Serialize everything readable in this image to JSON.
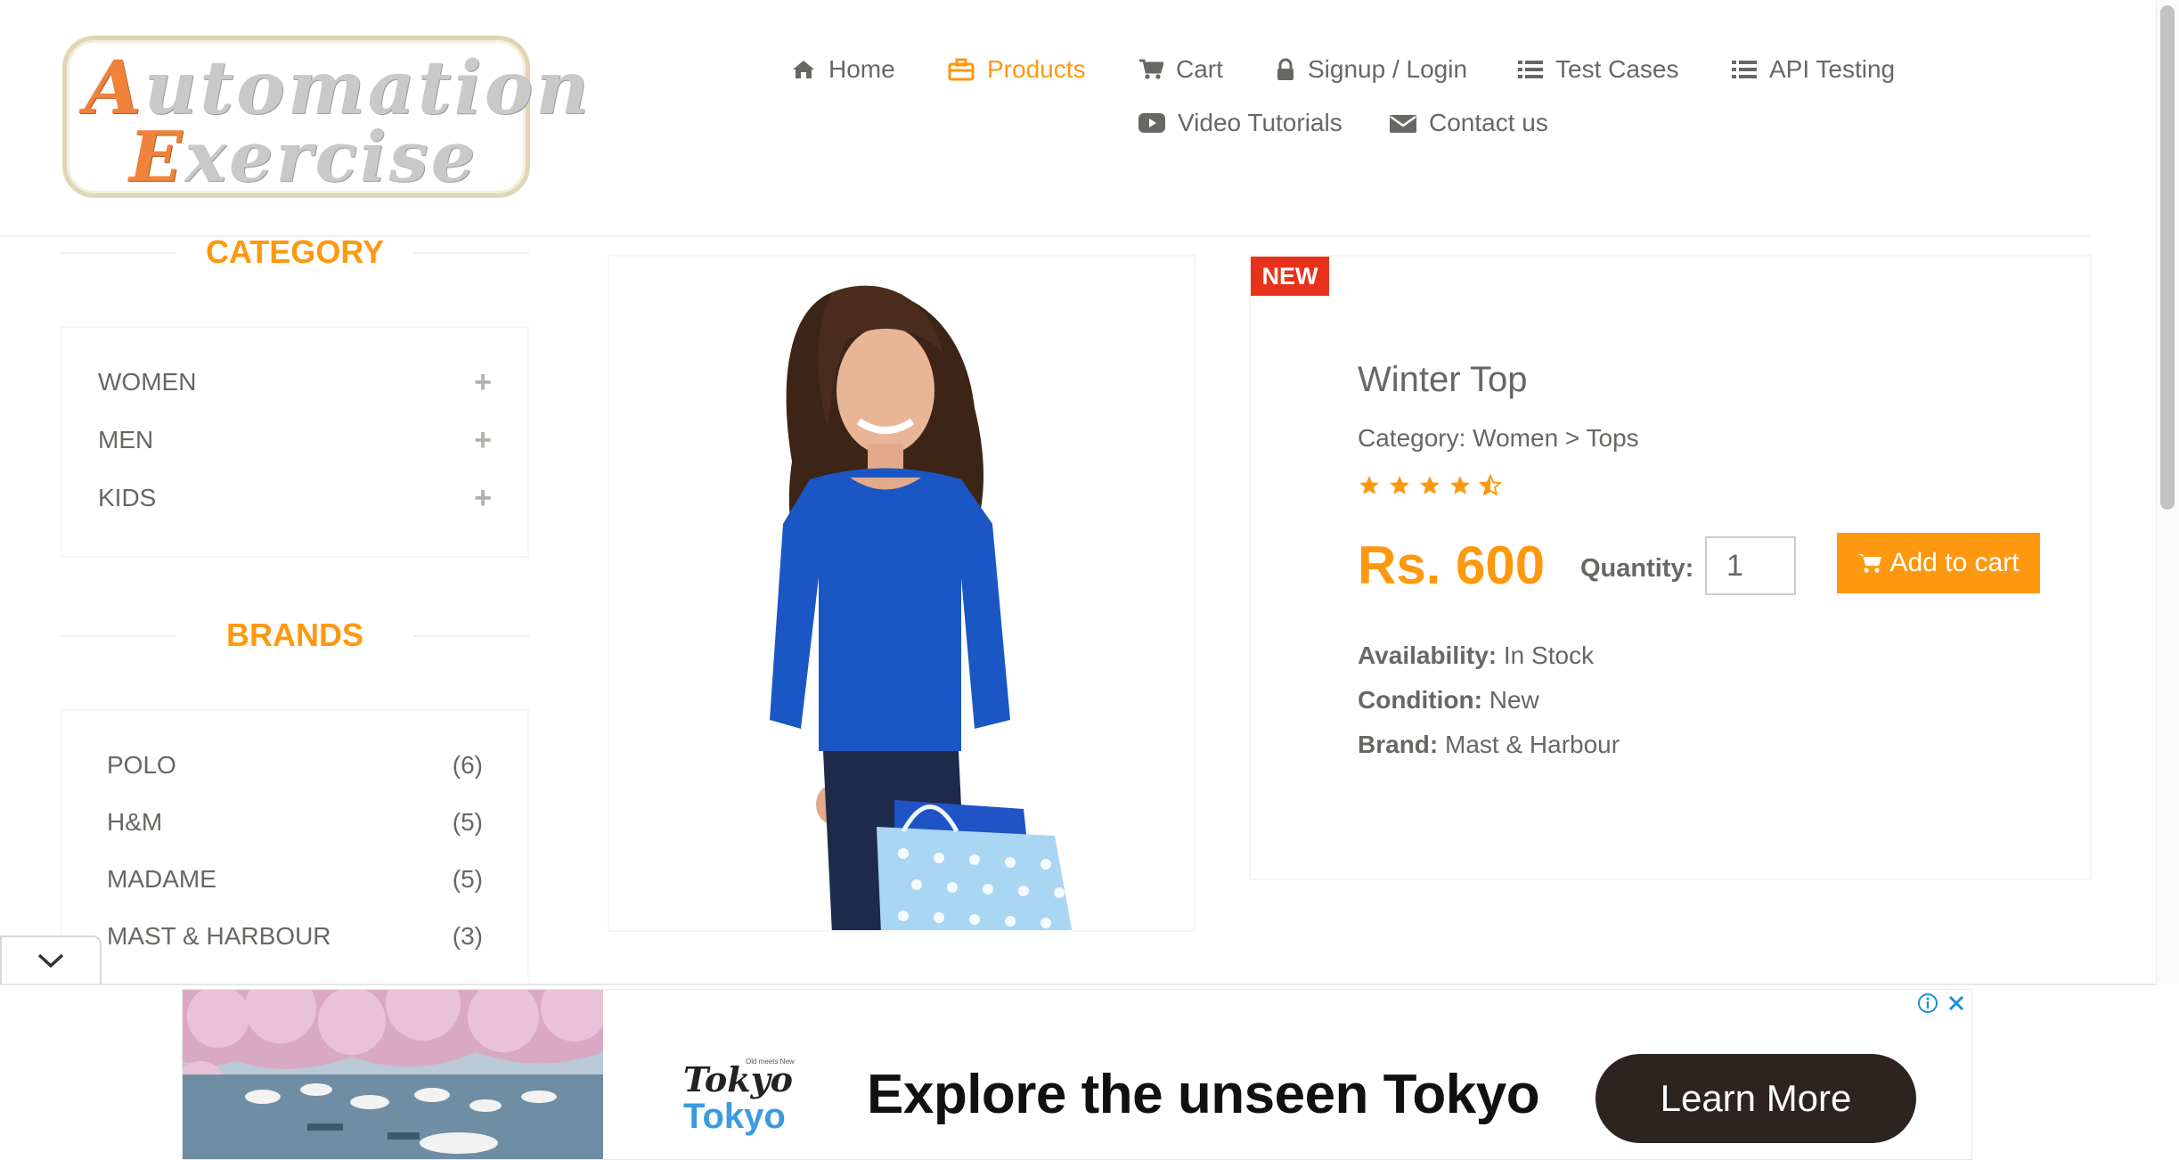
{
  "logo": {
    "line1_cap": "A",
    "line1_rest": "utomation",
    "line2_cap": "E",
    "line2_rest": "xercise"
  },
  "nav": {
    "home": "Home",
    "products": "Products",
    "cart": "Cart",
    "signup_login": "Signup / Login",
    "test_cases": "Test Cases",
    "api_testing": "API Testing",
    "video_tutorials": "Video Tutorials",
    "contact_us": "Contact us",
    "active_color": "#fe980f"
  },
  "sidebar": {
    "category_title": "CATEGORY",
    "categories": [
      {
        "label": "WOMEN",
        "icon": "plus-icon"
      },
      {
        "label": "MEN",
        "icon": "plus-icon"
      },
      {
        "label": "KIDS",
        "icon": "plus-icon"
      }
    ],
    "brands_title": "BRANDS",
    "brands": [
      {
        "name": "POLO",
        "count": "(6)"
      },
      {
        "name": "H&M",
        "count": "(5)"
      },
      {
        "name": "MADAME",
        "count": "(5)"
      },
      {
        "name": "MAST & HARBOUR",
        "count": "(3)"
      }
    ]
  },
  "product": {
    "badge": "NEW",
    "name": "Winter Top",
    "category": "Category: Women > Tops",
    "rating": 4.5,
    "rating_max": 5,
    "price": "Rs. 600",
    "quantity_label": "Quantity:",
    "quantity_value": "1",
    "add_to_cart": "Add to cart",
    "availability_label": "Availability:",
    "availability_value": " In Stock",
    "condition_label": "Condition:",
    "condition_value": " New",
    "brand_label": "Brand:",
    "brand_value": " Mast & Harbour",
    "accent_color": "#fe980f",
    "badge_color": "#e8331c"
  },
  "ad": {
    "logo_small": "Old meets New",
    "logo_top": "Tokyo",
    "logo_bottom": "Tokyo",
    "headline": "Explore the unseen Tokyo",
    "cta": "Learn More"
  }
}
